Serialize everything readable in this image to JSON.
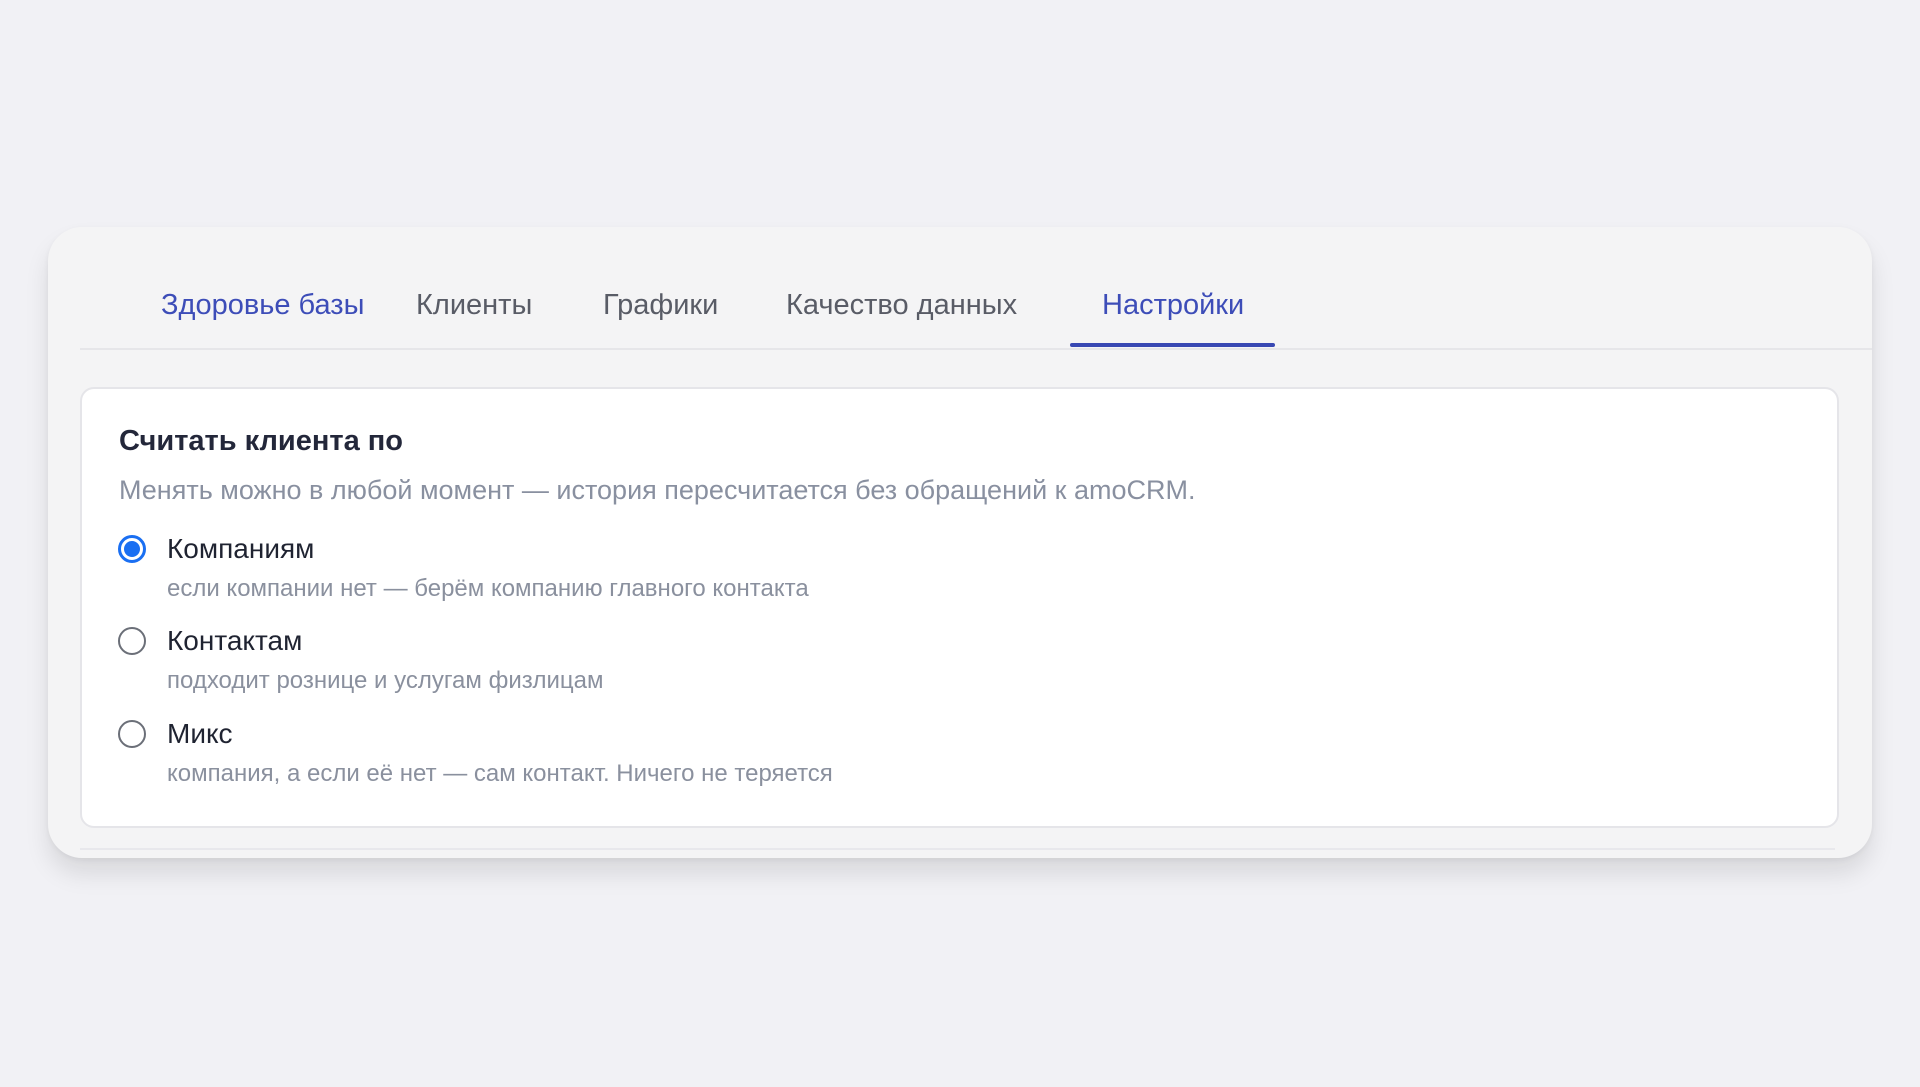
{
  "tabs": [
    {
      "label": "Здоровье базы",
      "active": false
    },
    {
      "label": "Клиенты",
      "active": false
    },
    {
      "label": "Графики",
      "active": false
    },
    {
      "label": "Качество данных",
      "active": false
    },
    {
      "label": "Настройки",
      "active": true
    }
  ],
  "settings": {
    "title": "Считать клиента по",
    "subtitle": "Менять можно в любой момент — история пересчитается без обращений к amoCRM.",
    "options": [
      {
        "label": "Компаниям",
        "description": "если компании нет — берём компанию главного контакта",
        "selected": true
      },
      {
        "label": "Контактам",
        "description": "подходит рознице и услугам физлицам",
        "selected": false
      },
      {
        "label": "Микс",
        "description": "компания, а если её нет — сам контакт. Ничего не теряется",
        "selected": false
      }
    ]
  },
  "colors": {
    "accent": "#3848b3",
    "radio_checked": "#1a6ff2",
    "tab_text": "#595c66",
    "muted_text": "#8990a0"
  }
}
